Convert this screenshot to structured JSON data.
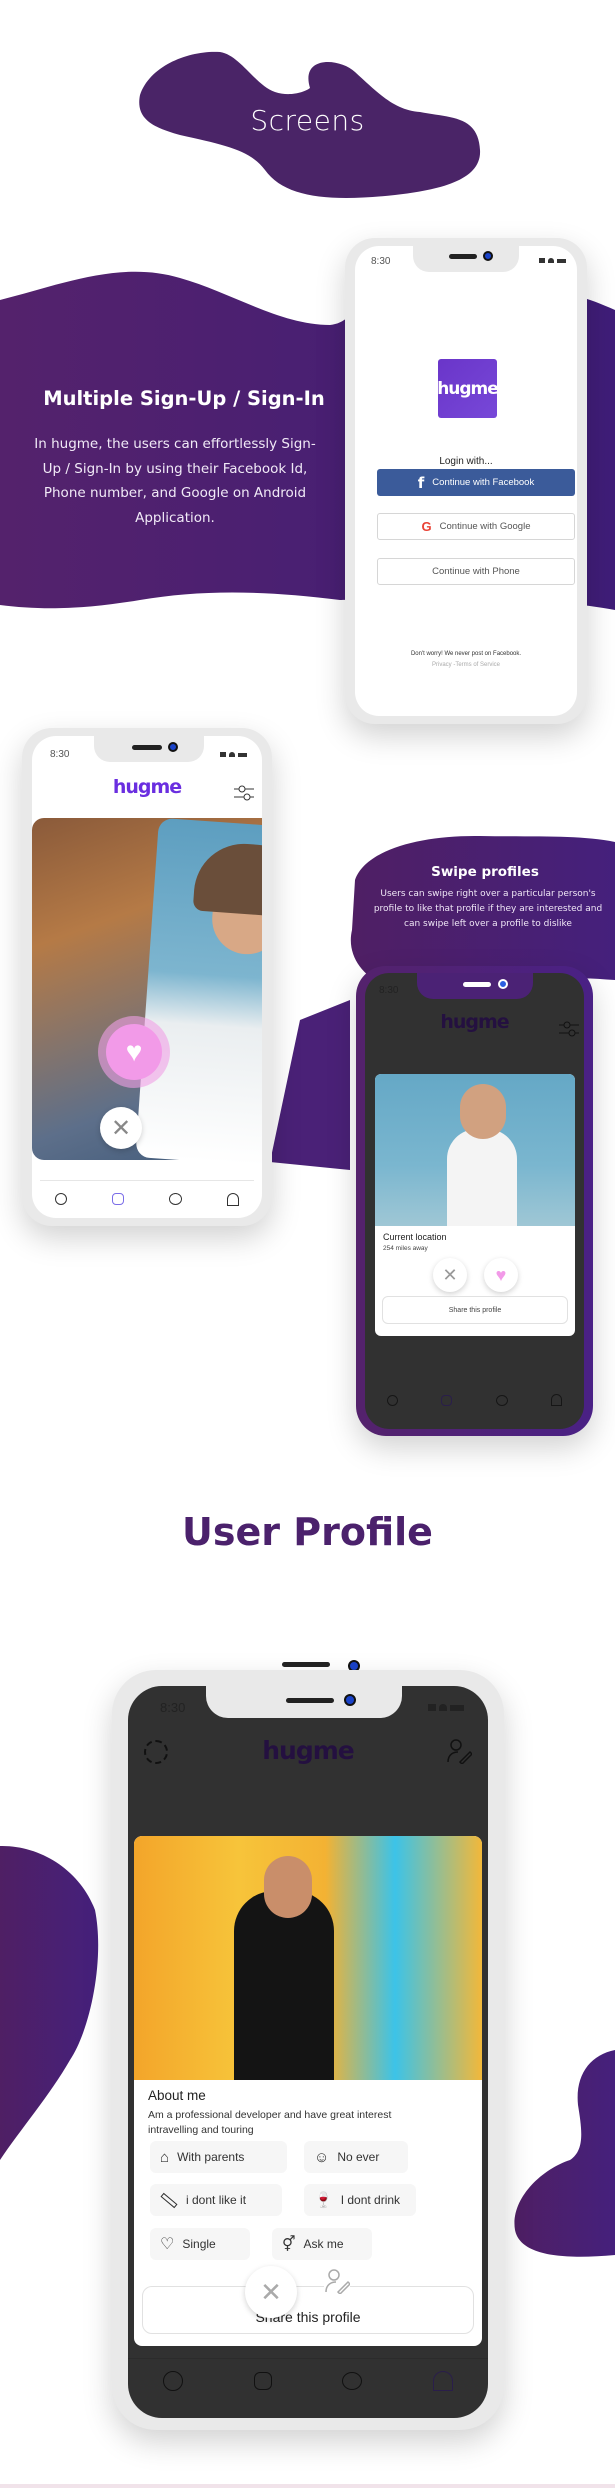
{
  "colors": {
    "brand_purple": "#4b216c",
    "brand_violet": "#6a2ee0",
    "facebook_blue": "#3b5b9a",
    "like_pink": "#f29ae8",
    "dark_screen": "#313131"
  },
  "screens_section": {
    "title": "Screens"
  },
  "signin_section": {
    "heading": "Multiple Sign-Up / Sign-In",
    "description": "In hugme, the users can effortlessly Sign-Up / Sign-In by using their Facebook Id, Phone number, and Google on Android Application.",
    "phone": {
      "time": "8:30",
      "logo_text": "hugme",
      "login_prompt": "Login with...",
      "buttons": [
        {
          "label": "Continue with Facebook",
          "icon": "facebook-icon"
        },
        {
          "label": "Continue with Google",
          "icon": "google-icon"
        },
        {
          "label": "Continue with Phone",
          "icon": ""
        }
      ],
      "disclaimer": "Don't worry! We never post on Facebook.",
      "legal_links": "Privacy -Terms of Service"
    }
  },
  "swipe_section": {
    "heading": "Swipe profiles",
    "description": "Users can swipe right over a particular person's profile to like that profile if they are interested and can swipe left over a profile to dislike",
    "feed_phone": {
      "time": "8:30",
      "logo_text": "hugme",
      "filter_icon": "sliders-icon",
      "tabs": [
        {
          "icon": "globe-icon",
          "active": false
        },
        {
          "icon": "cards-icon",
          "active": true
        },
        {
          "icon": "chat-icon",
          "active": false
        },
        {
          "icon": "user-icon",
          "active": false
        }
      ]
    },
    "detail_phone": {
      "time": "8:30",
      "logo_text": "hugme",
      "location_label": "Current location",
      "distance": "254 miles away",
      "share_label": "Share this profile"
    }
  },
  "profile_section": {
    "title": "User Profile",
    "phone": {
      "time": "8:30",
      "logo_text": "hugme",
      "about_heading": "About me",
      "about_text": "Am a professional developer and have great interest intravelling and touring",
      "attributes": [
        {
          "icon": "house-icon",
          "label": "With parents"
        },
        {
          "icon": "smiley-icon",
          "label": "No ever"
        },
        {
          "icon": "cigarette-icon",
          "label": "i dont like it"
        },
        {
          "icon": "glass-icon",
          "label": "I dont drink"
        },
        {
          "icon": "heart-icon",
          "label": "Single"
        },
        {
          "icon": "gender-icon",
          "label": "Ask me"
        }
      ],
      "share_label": "Share this profile"
    }
  }
}
